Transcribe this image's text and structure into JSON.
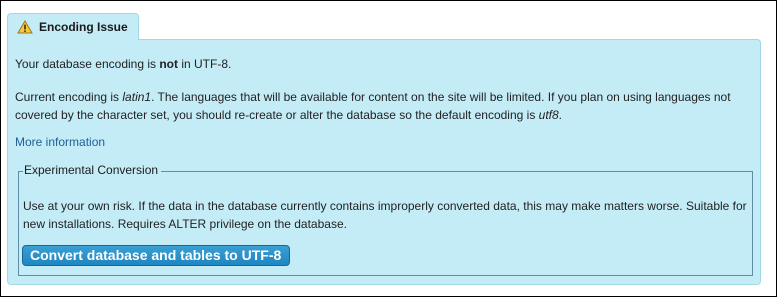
{
  "tab": {
    "icon": "warning-icon",
    "label": "Encoding Issue"
  },
  "status": {
    "prefix": "Your database encoding is ",
    "emphasis": "not",
    "suffix": " in UTF-8."
  },
  "details": {
    "part1": "Current encoding is ",
    "encoding": "latin1",
    "part2": ". The languages that will be available for content on the site will be limited. If you plan on using languages not covered by the character set, you should re-create or alter the database so the default encoding is ",
    "target_encoding": "utf8",
    "part3": "."
  },
  "more_link": "More information",
  "conversion": {
    "legend": "Experimental Conversion",
    "description": "Use at your own risk. If the data in the database currently contains improperly converted data, this may make matters worse. Suitable for new installations. Requires ALTER privilege on the database.",
    "button_label": "Convert database and tables to UTF-8"
  },
  "colors": {
    "panel_background": "#c4ecf7",
    "panel_border": "#a2d7e6",
    "link": "#1e5f96",
    "button": "#1e86c2"
  }
}
